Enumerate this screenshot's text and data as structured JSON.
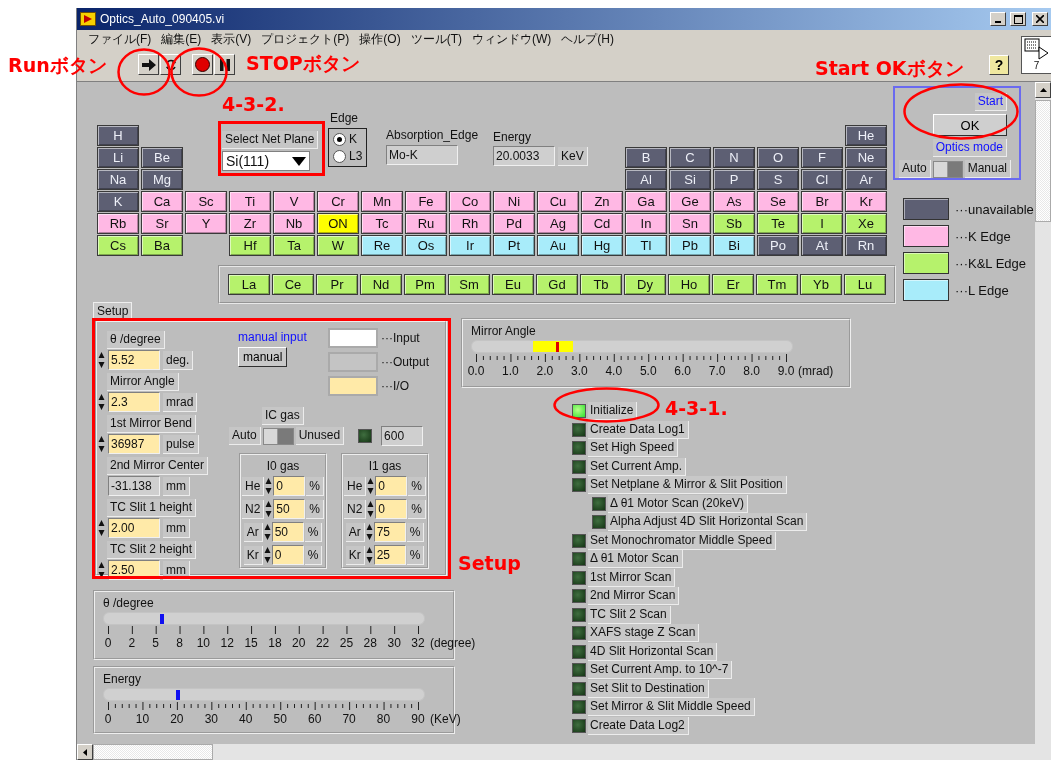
{
  "window": {
    "title": "Optics_Auto_090405.vi"
  },
  "menu": [
    "ファイル(F)",
    "編集(E)",
    "表示(V)",
    "プロジェクト(P)",
    "操作(O)",
    "ツール(T)",
    "ウィンドウ(W)",
    "ヘルプ(H)"
  ],
  "toolbar": {
    "help": "?"
  },
  "connector_pane": {
    "label": "7"
  },
  "annotations": [
    "Runボタン",
    "STOPボタン",
    "Start OKボタン",
    "4-3-2.",
    "4-3-1.",
    "Setup"
  ],
  "periodic_table": {
    "rows": [
      [
        {
          "symbol": "H",
          "kind": "unavailable",
          "selected": false
        },
        "",
        "",
        "",
        "",
        "",
        "",
        "",
        "",
        "",
        "",
        "",
        "",
        "",
        "",
        "",
        "",
        {
          "symbol": "He",
          "kind": "unavailable",
          "selected": false
        }
      ],
      [
        {
          "symbol": "Li",
          "kind": "unavailable",
          "selected": false
        },
        {
          "symbol": "Be",
          "kind": "unavailable",
          "selected": false
        },
        "",
        "",
        "",
        "",
        "",
        "",
        "",
        "",
        "",
        "",
        {
          "symbol": "B",
          "kind": "unavailable",
          "selected": false
        },
        {
          "symbol": "C",
          "kind": "unavailable",
          "selected": false
        },
        {
          "symbol": "N",
          "kind": "unavailable",
          "selected": false
        },
        {
          "symbol": "O",
          "kind": "unavailable",
          "selected": false
        },
        {
          "symbol": "F",
          "kind": "unavailable",
          "selected": false
        },
        {
          "symbol": "Ne",
          "kind": "unavailable",
          "selected": false
        }
      ],
      [
        {
          "symbol": "Na",
          "kind": "unavailable",
          "selected": false
        },
        {
          "symbol": "Mg",
          "kind": "unavailable",
          "selected": false
        },
        "",
        "",
        "",
        "",
        "",
        "",
        "",
        "",
        "",
        "",
        {
          "symbol": "Al",
          "kind": "unavailable",
          "selected": false
        },
        {
          "symbol": "Si",
          "kind": "unavailable",
          "selected": false
        },
        {
          "symbol": "P",
          "kind": "unavailable",
          "selected": false
        },
        {
          "symbol": "S",
          "kind": "unavailable",
          "selected": false
        },
        {
          "symbol": "Cl",
          "kind": "unavailable",
          "selected": false
        },
        {
          "symbol": "Ar",
          "kind": "unavailable",
          "selected": false
        }
      ],
      [
        {
          "symbol": "K",
          "kind": "unavailable",
          "selected": false
        },
        {
          "symbol": "Ca",
          "kind": "k",
          "selected": false
        },
        {
          "symbol": "Sc",
          "kind": "k",
          "selected": false
        },
        {
          "symbol": "Ti",
          "kind": "k",
          "selected": false
        },
        {
          "symbol": "V",
          "kind": "k",
          "selected": false
        },
        {
          "symbol": "Cr",
          "kind": "k",
          "selected": false
        },
        {
          "symbol": "Mn",
          "kind": "k",
          "selected": false
        },
        {
          "symbol": "Fe",
          "kind": "k",
          "selected": false
        },
        {
          "symbol": "Co",
          "kind": "k",
          "selected": false
        },
        {
          "symbol": "Ni",
          "kind": "k",
          "selected": false
        },
        {
          "symbol": "Cu",
          "kind": "k",
          "selected": false
        },
        {
          "symbol": "Zn",
          "kind": "k",
          "selected": false
        },
        {
          "symbol": "Ga",
          "kind": "k",
          "selected": false
        },
        {
          "symbol": "Ge",
          "kind": "k",
          "selected": false
        },
        {
          "symbol": "As",
          "kind": "k",
          "selected": false
        },
        {
          "symbol": "Se",
          "kind": "k",
          "selected": false
        },
        {
          "symbol": "Br",
          "kind": "k",
          "selected": false
        },
        {
          "symbol": "Kr",
          "kind": "k",
          "selected": false
        }
      ],
      [
        {
          "symbol": "Rb",
          "kind": "k",
          "selected": false
        },
        {
          "symbol": "Sr",
          "kind": "k",
          "selected": false
        },
        {
          "symbol": "Y",
          "kind": "k",
          "selected": false
        },
        {
          "symbol": "Zr",
          "kind": "k",
          "selected": false
        },
        {
          "symbol": "Nb",
          "kind": "k",
          "selected": false
        },
        {
          "symbol": "ON",
          "kind": "k",
          "selected": true
        },
        {
          "symbol": "Tc",
          "kind": "k",
          "selected": false
        },
        {
          "symbol": "Ru",
          "kind": "k",
          "selected": false
        },
        {
          "symbol": "Rh",
          "kind": "k",
          "selected": false
        },
        {
          "symbol": "Pd",
          "kind": "k",
          "selected": false
        },
        {
          "symbol": "Ag",
          "kind": "k",
          "selected": false
        },
        {
          "symbol": "Cd",
          "kind": "k",
          "selected": false
        },
        {
          "symbol": "In",
          "kind": "k",
          "selected": false
        },
        {
          "symbol": "Sn",
          "kind": "k",
          "selected": false
        },
        {
          "symbol": "Sb",
          "kind": "kl",
          "selected": false
        },
        {
          "symbol": "Te",
          "kind": "kl",
          "selected": false
        },
        {
          "symbol": "I",
          "kind": "kl",
          "selected": false
        },
        {
          "symbol": "Xe",
          "kind": "kl",
          "selected": false
        }
      ],
      [
        {
          "symbol": "Cs",
          "kind": "kl",
          "selected": false
        },
        {
          "symbol": "Ba",
          "kind": "kl",
          "selected": false
        },
        "",
        {
          "symbol": "Hf",
          "kind": "kl",
          "selected": false
        },
        {
          "symbol": "Ta",
          "kind": "kl",
          "selected": false
        },
        {
          "symbol": "W",
          "kind": "kl",
          "selected": false
        },
        {
          "symbol": "Re",
          "kind": "l",
          "selected": false
        },
        {
          "symbol": "Os",
          "kind": "l",
          "selected": false
        },
        {
          "symbol": "Ir",
          "kind": "l",
          "selected": false
        },
        {
          "symbol": "Pt",
          "kind": "l",
          "selected": false
        },
        {
          "symbol": "Au",
          "kind": "l",
          "selected": false
        },
        {
          "symbol": "Hg",
          "kind": "l",
          "selected": false
        },
        {
          "symbol": "Tl",
          "kind": "l",
          "selected": false
        },
        {
          "symbol": "Pb",
          "kind": "l",
          "selected": false
        },
        {
          "symbol": "Bi",
          "kind": "l",
          "selected": false
        },
        {
          "symbol": "Po",
          "kind": "unavailable",
          "selected": false
        },
        {
          "symbol": "At",
          "kind": "unavailable",
          "selected": false
        },
        {
          "symbol": "Rn",
          "kind": "unavailable",
          "selected": false
        }
      ]
    ],
    "lanthanides": [
      {
        "symbol": "La",
        "kind": "kl",
        "selected": false
      },
      {
        "symbol": "Ce",
        "kind": "kl",
        "selected": false
      },
      {
        "symbol": "Pr",
        "kind": "kl",
        "selected": false
      },
      {
        "symbol": "Nd",
        "kind": "kl",
        "selected": false
      },
      {
        "symbol": "Pm",
        "kind": "kl",
        "selected": false
      },
      {
        "symbol": "Sm",
        "kind": "kl",
        "selected": false
      },
      {
        "symbol": "Eu",
        "kind": "kl",
        "selected": false
      },
      {
        "symbol": "Gd",
        "kind": "kl",
        "selected": false
      },
      {
        "symbol": "Tb",
        "kind": "kl",
        "selected": false
      },
      {
        "symbol": "Dy",
        "kind": "kl",
        "selected": false
      },
      {
        "symbol": "Ho",
        "kind": "kl",
        "selected": false
      },
      {
        "symbol": "Er",
        "kind": "kl",
        "selected": false
      },
      {
        "symbol": "Tm",
        "kind": "kl",
        "selected": false
      },
      {
        "symbol": "Yb",
        "kind": "kl",
        "selected": false
      },
      {
        "symbol": "Lu",
        "kind": "kl",
        "selected": false
      }
    ]
  },
  "net_plane": {
    "label": "Select Net Plane",
    "value": "Si(111)"
  },
  "edge": {
    "label": "Edge",
    "options": [
      {
        "label": "K",
        "selected": true
      },
      {
        "label": "L3",
        "selected": false
      }
    ]
  },
  "absorption_edge": {
    "label": "Absorption_Edge",
    "value": "Mo-K"
  },
  "energy": {
    "label": "Energy",
    "value": "20.0033",
    "unit": "KeV"
  },
  "start_panel": {
    "start": "Start",
    "ok": "OK",
    "mode_label": "Optics mode",
    "left": "Auto",
    "right": "Manual",
    "manual": false
  },
  "legend": [
    {
      "kind": "unavailable",
      "label": "···unavailable"
    },
    {
      "kind": "k",
      "label": "···K Edge"
    },
    {
      "kind": "kl",
      "label": "···K&L Edge"
    },
    {
      "kind": "l",
      "label": "···L Edge"
    }
  ],
  "setup": {
    "tab": "Setup",
    "fields": [
      {
        "label": "θ /degree",
        "value": "5.52",
        "unit": "deg.",
        "kind": "control"
      },
      {
        "label": "Mirror Angle",
        "value": "2.3",
        "unit": "mrad",
        "kind": "control"
      },
      {
        "label": "1st Mirror Bend",
        "value": "36987",
        "unit": "pulse",
        "kind": "control"
      },
      {
        "label": "2nd Mirror Center",
        "value": "-31.138",
        "unit": "mm",
        "kind": "indicator"
      },
      {
        "label": "TC Slit 1 height",
        "value": "2.00",
        "unit": "mm",
        "kind": "control"
      },
      {
        "label": "TC Slit 2 height",
        "value": "2.50",
        "unit": "mm",
        "kind": "control"
      }
    ],
    "manual_input": {
      "title": "manual input",
      "button": "manual"
    },
    "io_legend": [
      {
        "kind": "input",
        "label": "···Input"
      },
      {
        "kind": "output",
        "label": "···Output"
      },
      {
        "kind": "io",
        "label": "···I/O"
      }
    ],
    "ic_gas": {
      "label": "IC gas",
      "left": "Auto",
      "right": "Unused",
      "unused": false,
      "led_on": false,
      "value": "600"
    },
    "gases": [
      {
        "title": "I0 gas",
        "rows": [
          {
            "gas": "He",
            "value": "0",
            "unit": "%"
          },
          {
            "gas": "N2",
            "value": "50",
            "unit": "%"
          },
          {
            "gas": "Ar",
            "value": "50",
            "unit": "%"
          },
          {
            "gas": "Kr",
            "value": "0",
            "unit": "%"
          }
        ]
      },
      {
        "title": "I1 gas",
        "rows": [
          {
            "gas": "He",
            "value": "0",
            "unit": "%"
          },
          {
            "gas": "N2",
            "value": "0",
            "unit": "%"
          },
          {
            "gas": "Ar",
            "value": "75",
            "unit": "%"
          },
          {
            "gas": "Kr",
            "value": "25",
            "unit": "%"
          }
        ]
      }
    ]
  },
  "sliders": [
    {
      "label": "Mirror Angle",
      "kind": "range",
      "minor_ticks": true,
      "level": 0.256,
      "ticks": [
        "0.0",
        "1.0",
        "2.0",
        "3.0",
        "4.0",
        "5.0",
        "6.0",
        "7.0",
        "8.0",
        "9.0"
      ],
      "unit": "(mrad)"
    },
    {
      "label": "θ /degree",
      "kind": "pointer",
      "minor_ticks": false,
      "level": 0.1725,
      "ticks": [
        "0",
        "2",
        "5",
        "8",
        "10",
        "12",
        "15",
        "18",
        "20",
        "22",
        "25",
        "28",
        "30",
        "32"
      ],
      "unit": "(degree)"
    },
    {
      "label": "Energy",
      "kind": "pointer",
      "minor_ticks": true,
      "level": 0.222,
      "ticks": [
        "0",
        "10",
        "20",
        "30",
        "40",
        "50",
        "60",
        "70",
        "80",
        "90"
      ],
      "unit": "(KeV)"
    }
  ],
  "steps": [
    {
      "label": "Initialize",
      "on": true
    },
    {
      "label": "Create Data Log1",
      "on": false
    },
    {
      "label": "Set High Speed",
      "on": false
    },
    {
      "label": "Set Current Amp.",
      "on": false
    },
    {
      "label": "Set Netplane & Mirror & Slit Position",
      "on": false,
      "children": [
        {
          "label": "Δ θ1 Motor Scan (20keV)",
          "on": false
        },
        {
          "label": "Alpha Adjust 4D Slit Horizontal Scan",
          "on": false
        }
      ]
    },
    {
      "label": "Set Monochromator Middle Speed",
      "on": false
    },
    {
      "label": "Δ θ1 Motor Scan",
      "on": false
    },
    {
      "label": "1st Mirror Scan",
      "on": false
    },
    {
      "label": "2nd Mirror Scan",
      "on": false
    },
    {
      "label": "TC Slit 2 Scan",
      "on": false
    },
    {
      "label": "XAFS stage Z Scan",
      "on": false
    },
    {
      "label": "4D Slit Horizontal Scan",
      "on": false
    },
    {
      "label": "Set Current Amp. to 10^-7",
      "on": false
    },
    {
      "label": "Set Slit to Destination",
      "on": false
    },
    {
      "label": "Set Mirror & Slit Middle Speed",
      "on": false
    },
    {
      "label": "Create Data Log2",
      "on": false
    }
  ]
}
